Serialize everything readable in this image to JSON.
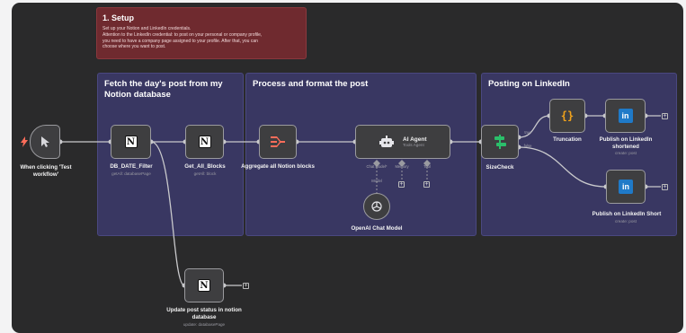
{
  "setup_note": {
    "title": "1. Setup",
    "line1": "Set up your Notion and LinkedIn credentials.",
    "line2": "Attention to the LinkedIn credential: to post on your personal or company profile,",
    "line3": "you need to have a company page assigned to your profile. After that, you can",
    "line4": "choose where you want to post."
  },
  "sections": {
    "fetch": "Fetch the day's post from my Notion database",
    "process": "Process and format the post",
    "posting": "Posting on LinkedIn"
  },
  "nodes": {
    "trigger": {
      "label": "When clicking 'Test workflow'"
    },
    "db_date_filter": {
      "label": "DB_DATE_Filter",
      "sub": "getAll: databasePage"
    },
    "get_all_blocks": {
      "label": "Get_All_Blocks",
      "sub": "getAll: block"
    },
    "aggregate": {
      "label": "Aggregate all Notion blocks"
    },
    "ai_agent": {
      "label": "AI Agent",
      "sub": "Tools Agent",
      "port_chat": "Chat Model*",
      "port_memory": "Memory",
      "port_tool": "Tool"
    },
    "openai": {
      "label": "OpenAI Chat Model",
      "port_model": "Model"
    },
    "sizecheck": {
      "label": "SizeCheck",
      "out_true": "true",
      "out_false": "false"
    },
    "truncation": {
      "label": "Truncation",
      "icon": "{}"
    },
    "publish_short": {
      "label": "Publish on LinkedIn shortened",
      "sub": "create: post"
    },
    "publish": {
      "label": "Publish on LinkedIn Short",
      "sub": "create: post"
    },
    "update_status": {
      "label": "Update post status in notion database",
      "sub": "update: databasePage"
    }
  },
  "icons": {
    "notion": "N",
    "linkedin": "in",
    "plus": "+"
  },
  "colors": {
    "canvas": "#2a2a2b",
    "setup_note": "#6f2a2f",
    "section": "#393762",
    "trigger_accent": "#ff6d5a",
    "linkedin": "#1f7ac8",
    "truncation": "#f0a21b",
    "sizecheck": "#2bbf6a"
  }
}
